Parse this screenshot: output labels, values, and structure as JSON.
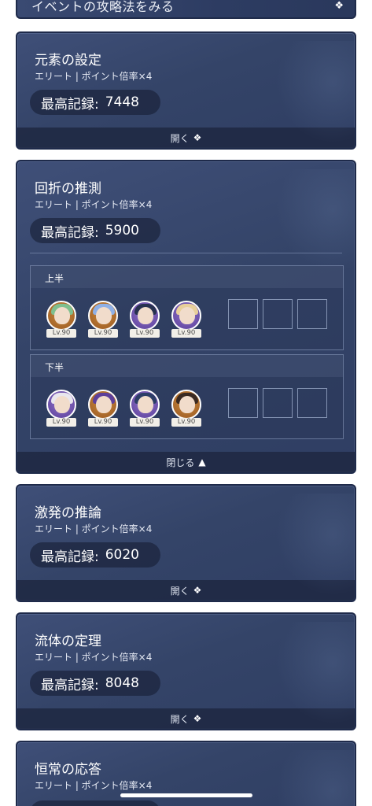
{
  "top_bar": {
    "text": "イベントの攻略法をみる",
    "arrow": "❖"
  },
  "cards": [
    {
      "title": "元素の設定",
      "subtitle": "エリート | ポイント倍率×4",
      "record_label": "最高記録:",
      "record_value": "7448",
      "footer": "開く",
      "footer_arrow": "❖"
    },
    {
      "title": "回折の推測",
      "subtitle": "エリート | ポイント倍率×4",
      "record_label": "最高記録:",
      "record_value": "5900",
      "footer": "閉じる",
      "footer_arrow": "▲",
      "halves": [
        {
          "label": "上半",
          "levels": [
            "Lv.90",
            "Lv.90",
            "Lv.90",
            "Lv.90"
          ]
        },
        {
          "label": "下半",
          "levels": [
            "Lv.90",
            "Lv.90",
            "Lv.90",
            "Lv.90"
          ]
        }
      ]
    },
    {
      "title": "激発の推論",
      "subtitle": "エリート | ポイント倍率×4",
      "record_label": "最高記録:",
      "record_value": "6020",
      "footer": "開く",
      "footer_arrow": "❖"
    },
    {
      "title": "流体の定理",
      "subtitle": "エリート | ポイント倍率×4",
      "record_label": "最高記録:",
      "record_value": "8048",
      "footer": "開く",
      "footer_arrow": "❖"
    },
    {
      "title": "恒常の応答",
      "subtitle": "エリート | ポイント倍率×4"
    }
  ],
  "colors": {
    "card_bg": "#344468",
    "card_border": "#1e2a4a",
    "avatar_gold": "#c98a3e",
    "avatar_purple": "#8f72c8"
  }
}
